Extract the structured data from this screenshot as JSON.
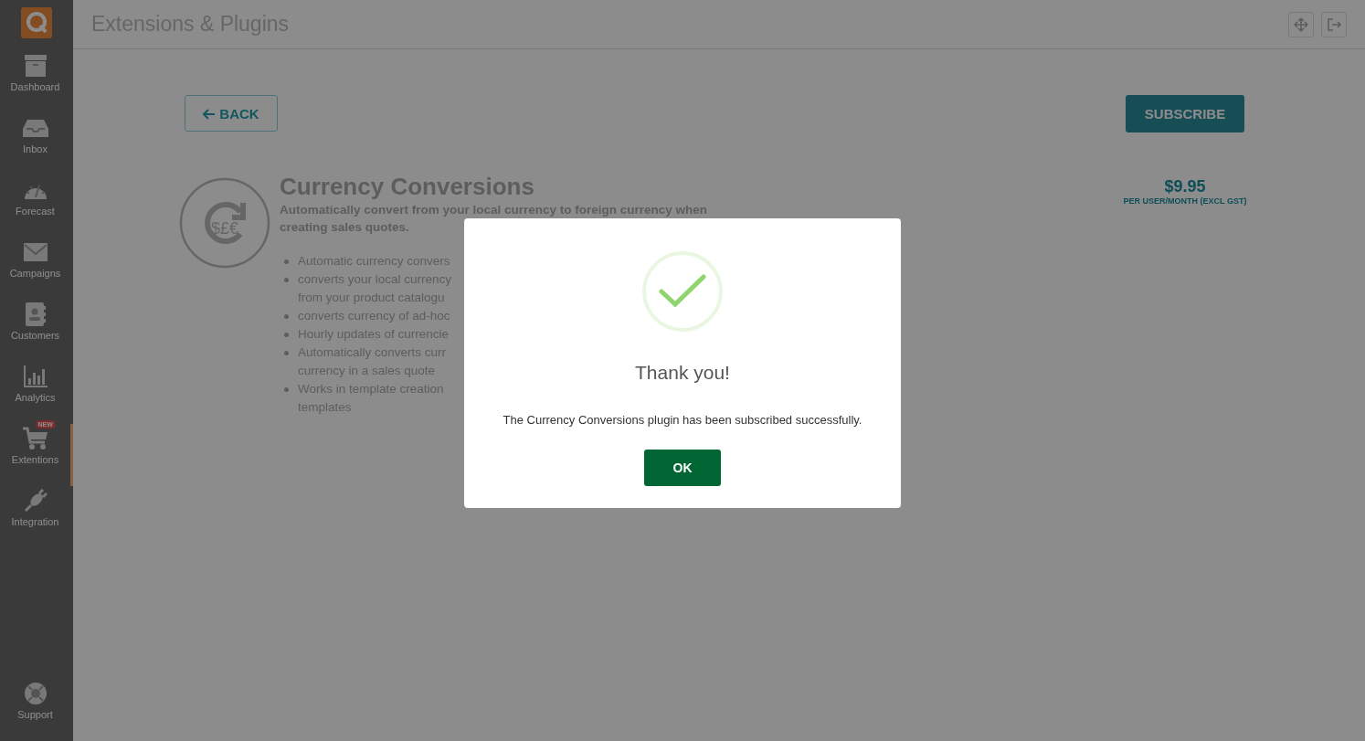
{
  "sidebar": {
    "items": [
      {
        "kind": "dashboard",
        "label": "Dashboard",
        "selected": false
      },
      {
        "kind": "inbox",
        "label": "Inbox",
        "selected": false
      },
      {
        "kind": "forecast",
        "label": "Forecast",
        "selected": false
      },
      {
        "kind": "campaigns",
        "label": "Campaigns",
        "selected": false
      },
      {
        "kind": "customers",
        "label": "Customers",
        "selected": false
      },
      {
        "kind": "analytics",
        "label": "Analytics",
        "selected": false
      },
      {
        "kind": "extensions",
        "label": "Extentions",
        "selected": true,
        "badge": "NEW"
      },
      {
        "kind": "integration",
        "label": "Integration",
        "selected": false
      }
    ],
    "support": "Support"
  },
  "header": {
    "title": "Extensions & Plugins"
  },
  "back_button": "BACK",
  "subscribe_button": "SUBSCRIBE",
  "plugin": {
    "icon_symbols": "$£€",
    "title": "Currency Conversions",
    "description": "Automatically convert from your local currency to foreign currency when creating sales quotes.",
    "price": "$9.95",
    "price_note": "PER USER/MONTH (EXCL GST)",
    "features": [
      [
        "Automatic currency convers"
      ],
      [
        "converts your local currency",
        "from your product catalogu"
      ],
      [
        "converts currency of ad-hoc"
      ],
      [
        "Hourly updates of currencie"
      ],
      [
        "Automatically converts curr",
        "currency in a sales quote"
      ],
      [
        "Works in template creation",
        "templates"
      ]
    ]
  },
  "dialog": {
    "title": "Thank you!",
    "message": "The Currency Conversions plugin has been subscribed successfully.",
    "button": "OK"
  }
}
